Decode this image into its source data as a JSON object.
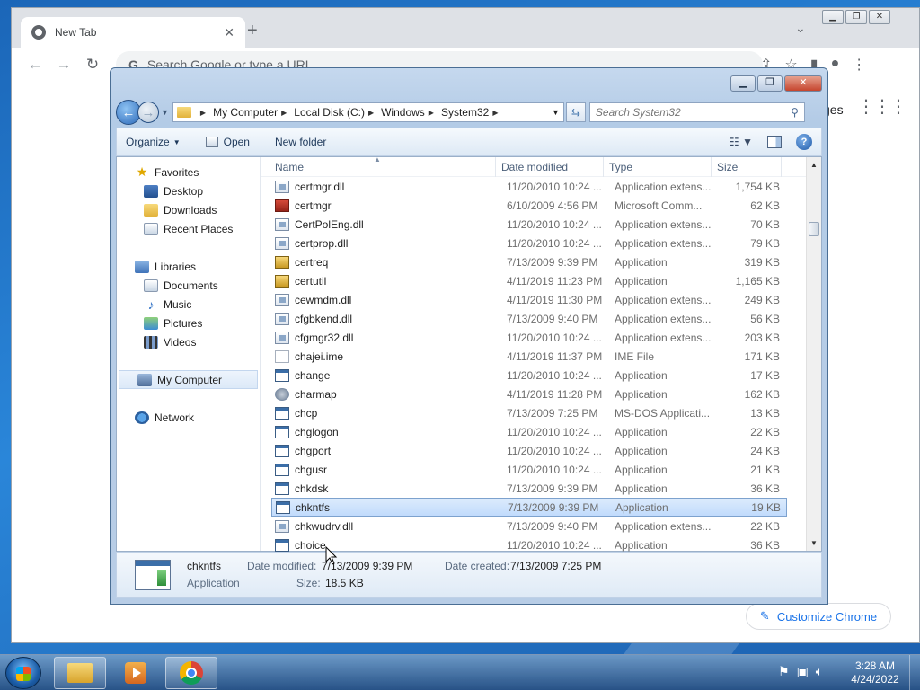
{
  "chrome": {
    "tab_title": "New Tab",
    "omnibox_placeholder": "Search Google or type a URL",
    "images_link": "ges",
    "customize_label": "Customize Chrome"
  },
  "explorer": {
    "breadcrumbs": [
      "My Computer",
      "Local Disk (C:)",
      "Windows",
      "System32"
    ],
    "search_placeholder": "Search System32",
    "commands": {
      "organize": "Organize",
      "open": "Open",
      "new_folder": "New folder"
    },
    "nav": {
      "favorites": "Favorites",
      "favorites_items": [
        "Desktop",
        "Downloads",
        "Recent Places"
      ],
      "libraries": "Libraries",
      "libraries_items": [
        "Documents",
        "Music",
        "Pictures",
        "Videos"
      ],
      "my_computer": "My Computer",
      "network": "Network"
    },
    "columns": {
      "name": "Name",
      "date": "Date modified",
      "type": "Type",
      "size": "Size"
    },
    "files": [
      {
        "name": "certmgr.dll",
        "date": "11/20/2010 10:24 ...",
        "type": "Application extens...",
        "size": "1,754 KB",
        "icon": "dll"
      },
      {
        "name": "certmgr",
        "date": "6/10/2009 4:56 PM",
        "type": "Microsoft Comm...",
        "size": "62 KB",
        "icon": "mmc"
      },
      {
        "name": "CertPolEng.dll",
        "date": "11/20/2010 10:24 ...",
        "type": "Application extens...",
        "size": "70 KB",
        "icon": "dll"
      },
      {
        "name": "certprop.dll",
        "date": "11/20/2010 10:24 ...",
        "type": "Application extens...",
        "size": "79 KB",
        "icon": "dll"
      },
      {
        "name": "certreq",
        "date": "7/13/2009 9:39 PM",
        "type": "Application",
        "size": "319 KB",
        "icon": "cert"
      },
      {
        "name": "certutil",
        "date": "4/11/2019 11:23 PM",
        "type": "Application",
        "size": "1,165 KB",
        "icon": "cert"
      },
      {
        "name": "cewmdm.dll",
        "date": "4/11/2019 11:30 PM",
        "type": "Application extens...",
        "size": "249 KB",
        "icon": "dll"
      },
      {
        "name": "cfgbkend.dll",
        "date": "7/13/2009 9:40 PM",
        "type": "Application extens...",
        "size": "56 KB",
        "icon": "dll"
      },
      {
        "name": "cfgmgr32.dll",
        "date": "11/20/2010 10:24 ...",
        "type": "Application extens...",
        "size": "203 KB",
        "icon": "dll"
      },
      {
        "name": "chajei.ime",
        "date": "4/11/2019 11:37 PM",
        "type": "IME File",
        "size": "171 KB",
        "icon": "ime"
      },
      {
        "name": "change",
        "date": "11/20/2010 10:24 ...",
        "type": "Application",
        "size": "17 KB",
        "icon": "app"
      },
      {
        "name": "charmap",
        "date": "4/11/2019 11:28 PM",
        "type": "Application",
        "size": "162 KB",
        "icon": "charmap"
      },
      {
        "name": "chcp",
        "date": "7/13/2009 7:25 PM",
        "type": "MS-DOS Applicati...",
        "size": "13 KB",
        "icon": "app"
      },
      {
        "name": "chglogon",
        "date": "11/20/2010 10:24 ...",
        "type": "Application",
        "size": "22 KB",
        "icon": "app"
      },
      {
        "name": "chgport",
        "date": "11/20/2010 10:24 ...",
        "type": "Application",
        "size": "24 KB",
        "icon": "app"
      },
      {
        "name": "chgusr",
        "date": "11/20/2010 10:24 ...",
        "type": "Application",
        "size": "21 KB",
        "icon": "app"
      },
      {
        "name": "chkdsk",
        "date": "7/13/2009 9:39 PM",
        "type": "Application",
        "size": "36 KB",
        "icon": "app"
      },
      {
        "name": "chkntfs",
        "date": "7/13/2009 9:39 PM",
        "type": "Application",
        "size": "19 KB",
        "icon": "app",
        "selected": true
      },
      {
        "name": "chkwudrv.dll",
        "date": "7/13/2009 9:40 PM",
        "type": "Application extens...",
        "size": "22 KB",
        "icon": "dll"
      },
      {
        "name": "choice",
        "date": "11/20/2010 10:24 ...",
        "type": "Application",
        "size": "36 KB",
        "icon": "app"
      }
    ],
    "details": {
      "name": "chkntfs",
      "type": "Application",
      "date_modified_label": "Date modified:",
      "date_modified": "7/13/2009 9:39 PM",
      "date_created_label": "Date created:",
      "date_created": "7/13/2009 7:25 PM",
      "size_label": "Size:",
      "size": "18.5 KB"
    }
  },
  "taskbar": {
    "time": "3:28 AM",
    "date": "4/24/2022"
  }
}
